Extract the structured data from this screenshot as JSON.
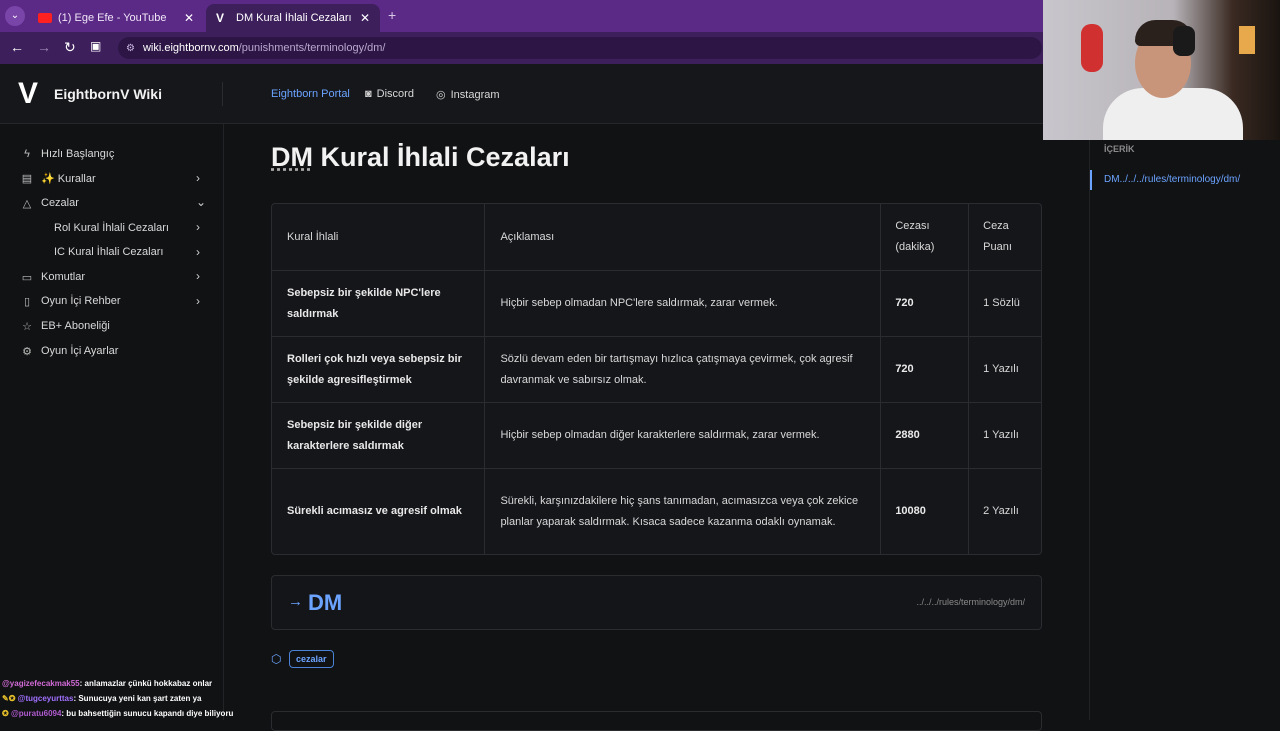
{
  "browser": {
    "tabs": [
      {
        "title": "(1) Ege Efe - YouTube",
        "icon": "youtube-icon"
      },
      {
        "title": "DM Kural İhlali Cezaları",
        "icon": "eightborn-v-icon"
      }
    ],
    "url_domain": "wiki.eightbornv.com",
    "url_path": "/punishments/terminology/dm/"
  },
  "header": {
    "brand": "EightbornV Wiki",
    "logo_letter": "V",
    "links": [
      "Eightborn Portal",
      "Discord",
      "Instagram"
    ]
  },
  "sidebar": {
    "items": [
      {
        "label": "Hızlı Başlangıç",
        "icon": "bolt-icon"
      },
      {
        "label": "✨ Kurallar",
        "icon": "book-icon"
      },
      {
        "label": "Cezalar",
        "icon": "warning-icon"
      },
      {
        "label": "Rol Kural İhlali Cezaları"
      },
      {
        "label": "IC Kural İhlali Cezaları"
      },
      {
        "label": "Komutlar",
        "icon": "terminal-icon"
      },
      {
        "label": "Oyun İçi Rehber",
        "icon": "document-icon"
      },
      {
        "label": "EB+ Aboneliği",
        "icon": "star-icon"
      },
      {
        "label": "Oyun İçi Ayarlar",
        "icon": "gear-icon"
      }
    ]
  },
  "page": {
    "title_dm": "DM",
    "title_rest": " Kural İhlali Cezaları",
    "table": {
      "headers": [
        "Kural İhlali",
        "Açıklaması",
        "Cezası (dakika)",
        "Ceza Puanı"
      ],
      "rows": [
        {
          "ihlal": "Sebepsiz bir şekilde NPC'lere saldırmak",
          "aciklama": "Hiçbir sebep olmadan NPC'lere saldırmak, zarar vermek.",
          "ceza": "720",
          "puan": "1 Sözlü"
        },
        {
          "ihlal": "Rolleri çok hızlı veya sebepsiz bir şekilde agresifleştirmek",
          "aciklama": "Sözlü devam eden bir tartışmayı hızlıca çatışmaya çevirmek, çok agresif davranmak ve sabırsız olmak.",
          "ceza": "720",
          "puan": "1 Yazılı"
        },
        {
          "ihlal": "Sebepsiz bir şekilde diğer karakterlere saldırmak",
          "aciklama": "Hiçbir sebep olmadan diğer karakterlere saldırmak, zarar vermek.",
          "ceza": "2880",
          "puan": "1 Yazılı"
        },
        {
          "ihlal": "Sürekli acımasız ve agresif olmak",
          "aciklama": "Sürekli, karşınızdakilere hiç şans tanımadan, acımasızca veya çok zekice planlar yaparak saldırmak. Kısaca sadece kazanma odaklı oynamak.",
          "ceza": "10080",
          "puan": "2 Yazılı"
        }
      ]
    },
    "link_card": {
      "label": "DM",
      "path": "../../../rules/terminology/dm/"
    },
    "tag": "cezalar"
  },
  "toc": {
    "heading": "İÇERİK",
    "link": "DM../../../rules/terminology/dm/"
  },
  "chat": [
    {
      "user": "@yagizefecakmak55",
      "msg": ": anlamazlar çünkü hokkabaz onlar"
    },
    {
      "user": "@tugceyurttas",
      "msg": ": Sunucuya yeni kan şart zaten ya"
    },
    {
      "user": "@puratu6094",
      "msg": ": bu bahsettiğin sunucu kapandı diye biliyoru"
    }
  ],
  "colors": {
    "accent": "#6ba3ff",
    "tabbar": "#5b2a86",
    "background": "#111214"
  }
}
